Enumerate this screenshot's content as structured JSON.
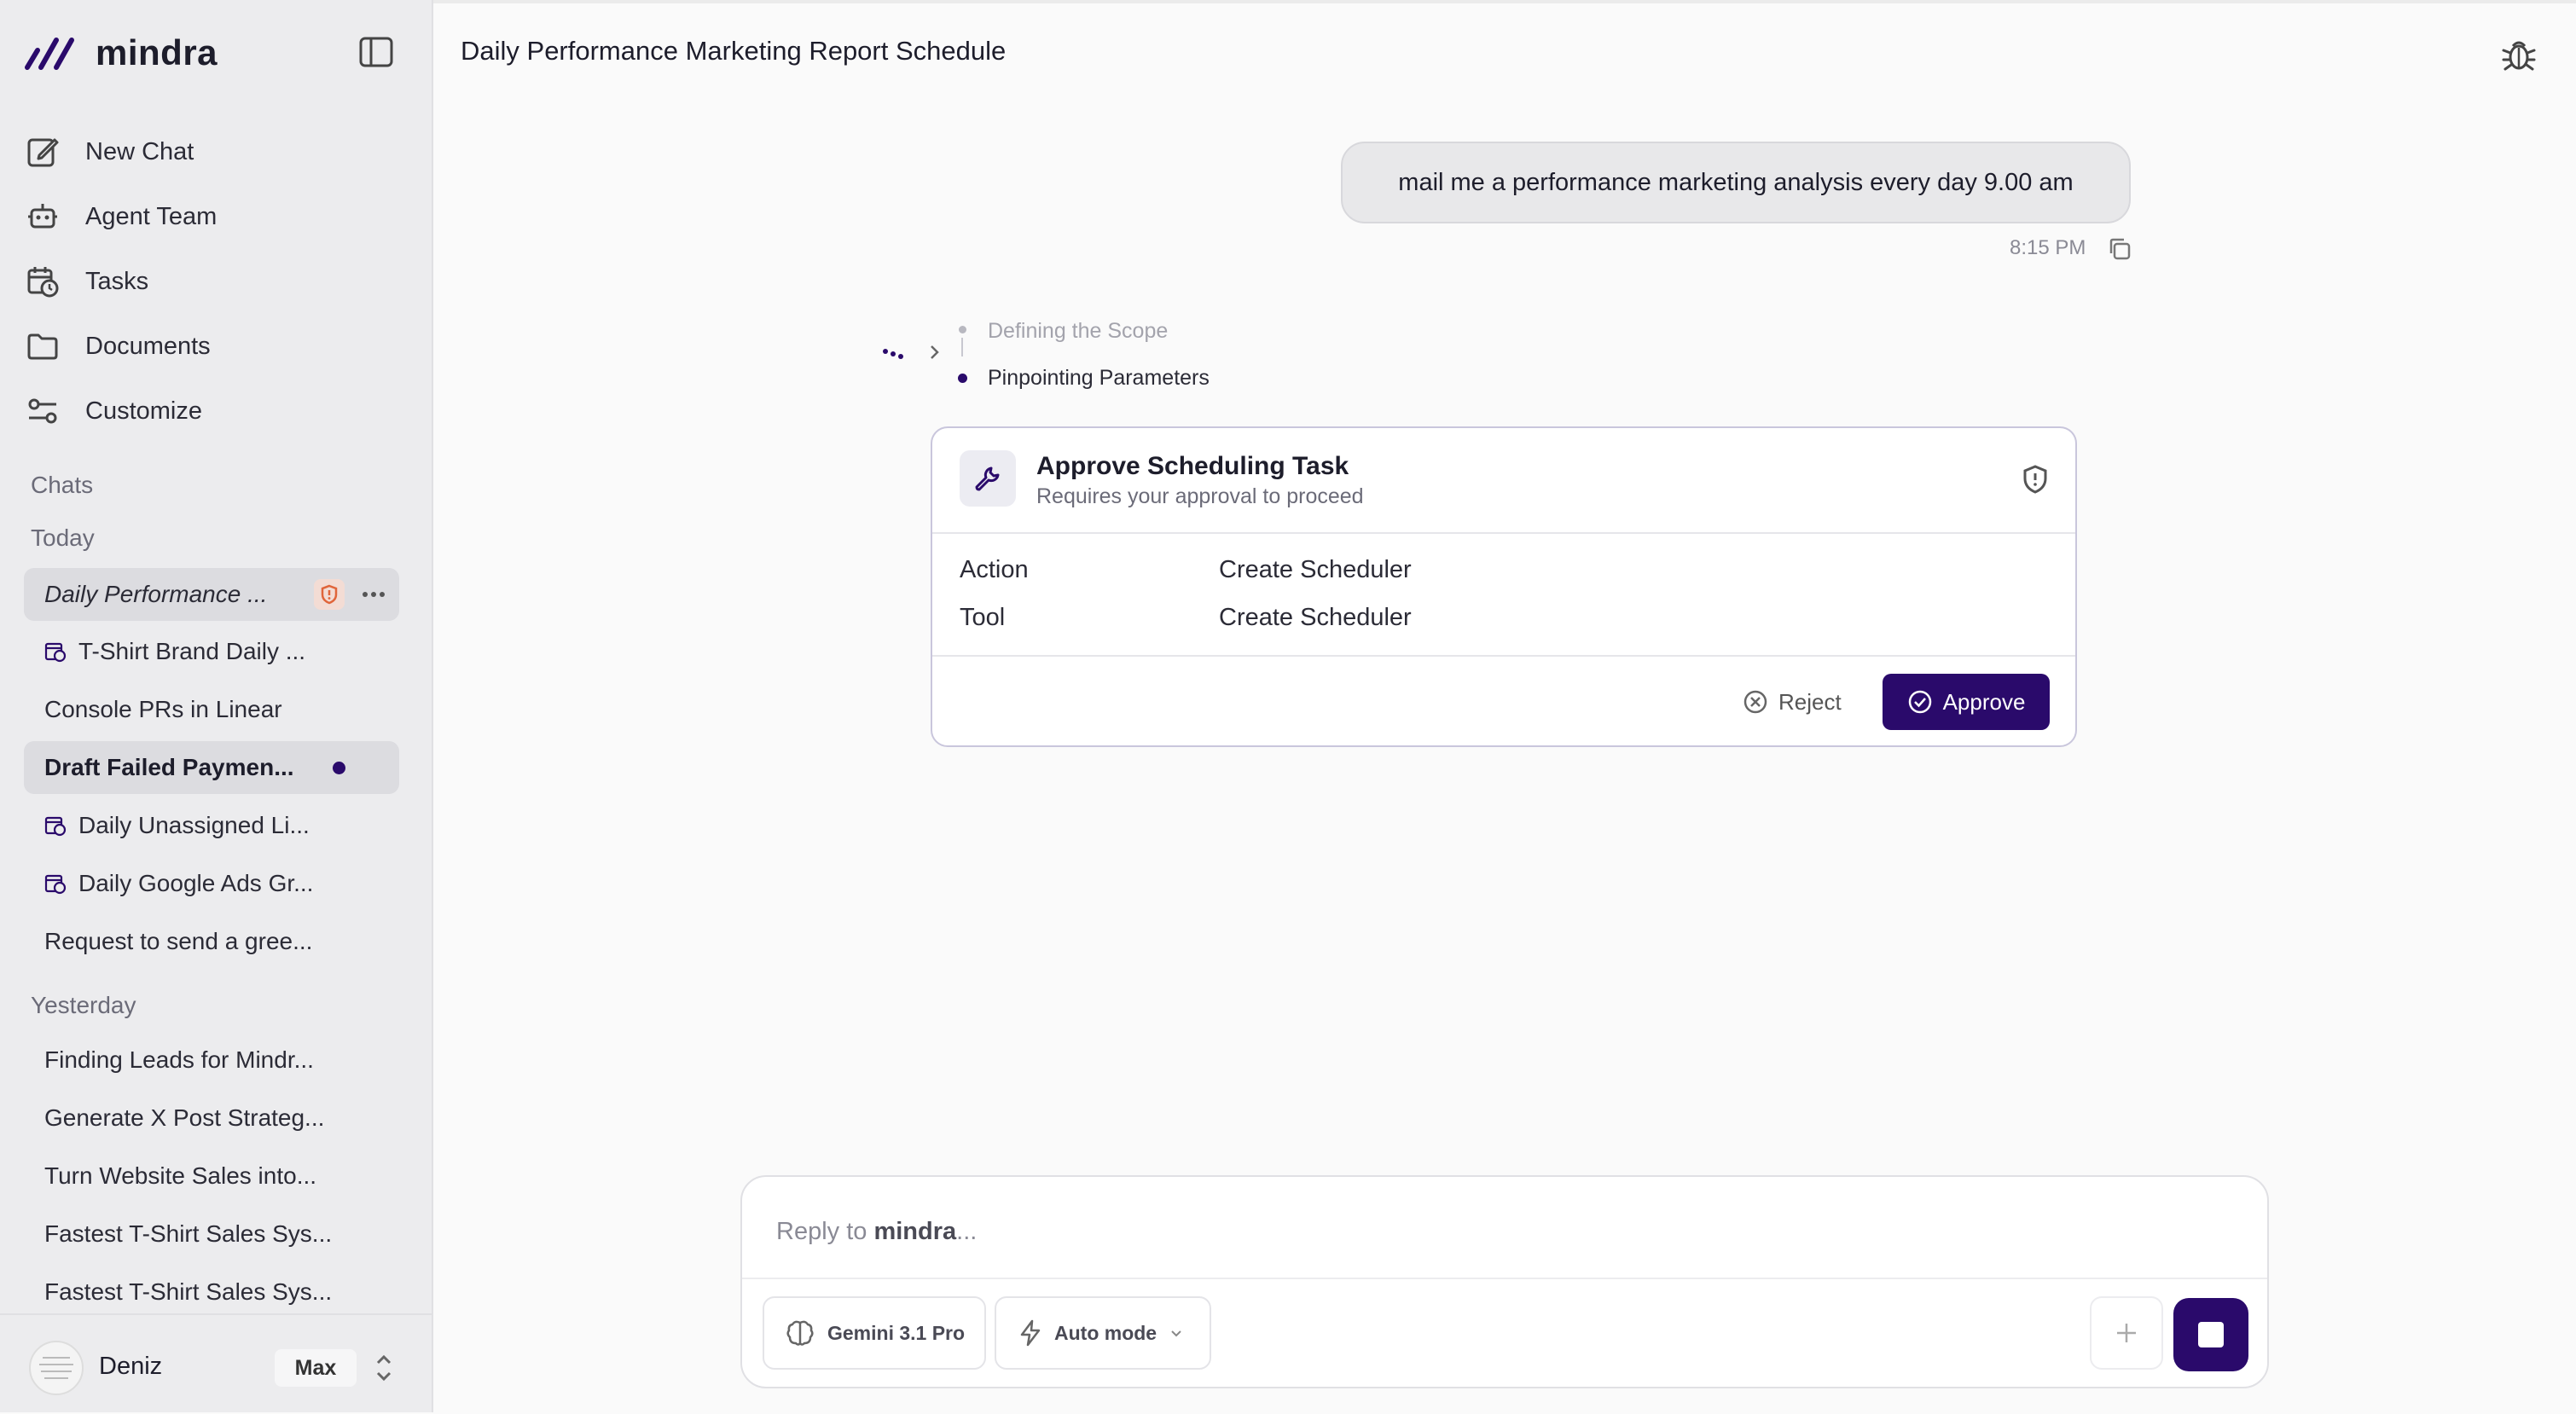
{
  "app": {
    "name": "mindra"
  },
  "nav": [
    {
      "label": "New Chat",
      "icon": "edit-icon"
    },
    {
      "label": "Agent Team",
      "icon": "robot-icon"
    },
    {
      "label": "Tasks",
      "icon": "calendar-clock-icon"
    },
    {
      "label": "Documents",
      "icon": "folder-icon"
    },
    {
      "label": "Customize",
      "icon": "sliders-icon"
    }
  ],
  "sidebar": {
    "chats_label": "Chats",
    "today_label": "Today",
    "yesterday_label": "Yesterday",
    "today": [
      {
        "title": "Daily Performance ...",
        "scheduled": false,
        "state": "active-pending-approval"
      },
      {
        "title": "T-Shirt Brand Daily ...",
        "scheduled": true
      },
      {
        "title": "Console PRs in Linear",
        "scheduled": false
      },
      {
        "title": "Draft Failed Paymen...",
        "scheduled": false,
        "state": "unread"
      },
      {
        "title": "Daily Unassigned Li...",
        "scheduled": true
      },
      {
        "title": "Daily Google Ads Gr...",
        "scheduled": true
      },
      {
        "title": "Request to send a gree...",
        "scheduled": false
      }
    ],
    "yesterday": [
      {
        "title": "Finding Leads for Mindr..."
      },
      {
        "title": "Generate X Post Strateg..."
      },
      {
        "title": "Turn Website Sales into..."
      },
      {
        "title": "Fastest T-Shirt Sales Sys..."
      },
      {
        "title": "Fastest T-Shirt Sales Sys..."
      }
    ]
  },
  "user": {
    "name": "Deniz",
    "plan": "Max"
  },
  "conversation": {
    "title": "Daily Performance Marketing Report Schedule",
    "user_message": "mail me a performance marketing analysis every day 9.00 am",
    "message_time": "8:15 PM",
    "thinking_steps": [
      "Defining the Scope",
      "Pinpointing Parameters"
    ]
  },
  "approval": {
    "title": "Approve Scheduling Task",
    "subtitle": "Requires your approval to proceed",
    "rows": [
      {
        "key": "Action",
        "value": "Create Scheduler"
      },
      {
        "key": "Tool",
        "value": "Create Scheduler"
      }
    ],
    "reject_label": "Reject",
    "approve_label": "Approve"
  },
  "composer": {
    "placeholder_prefix": "Reply to ",
    "placeholder_name": "mindra",
    "placeholder_suffix": "...",
    "model": "Gemini 3.1 Pro",
    "mode": "Auto mode"
  },
  "colors": {
    "accent": "#2a0a6b",
    "sidebar_bg": "#ececee",
    "page_bg": "#fafafa",
    "warning": "#e0653a"
  }
}
